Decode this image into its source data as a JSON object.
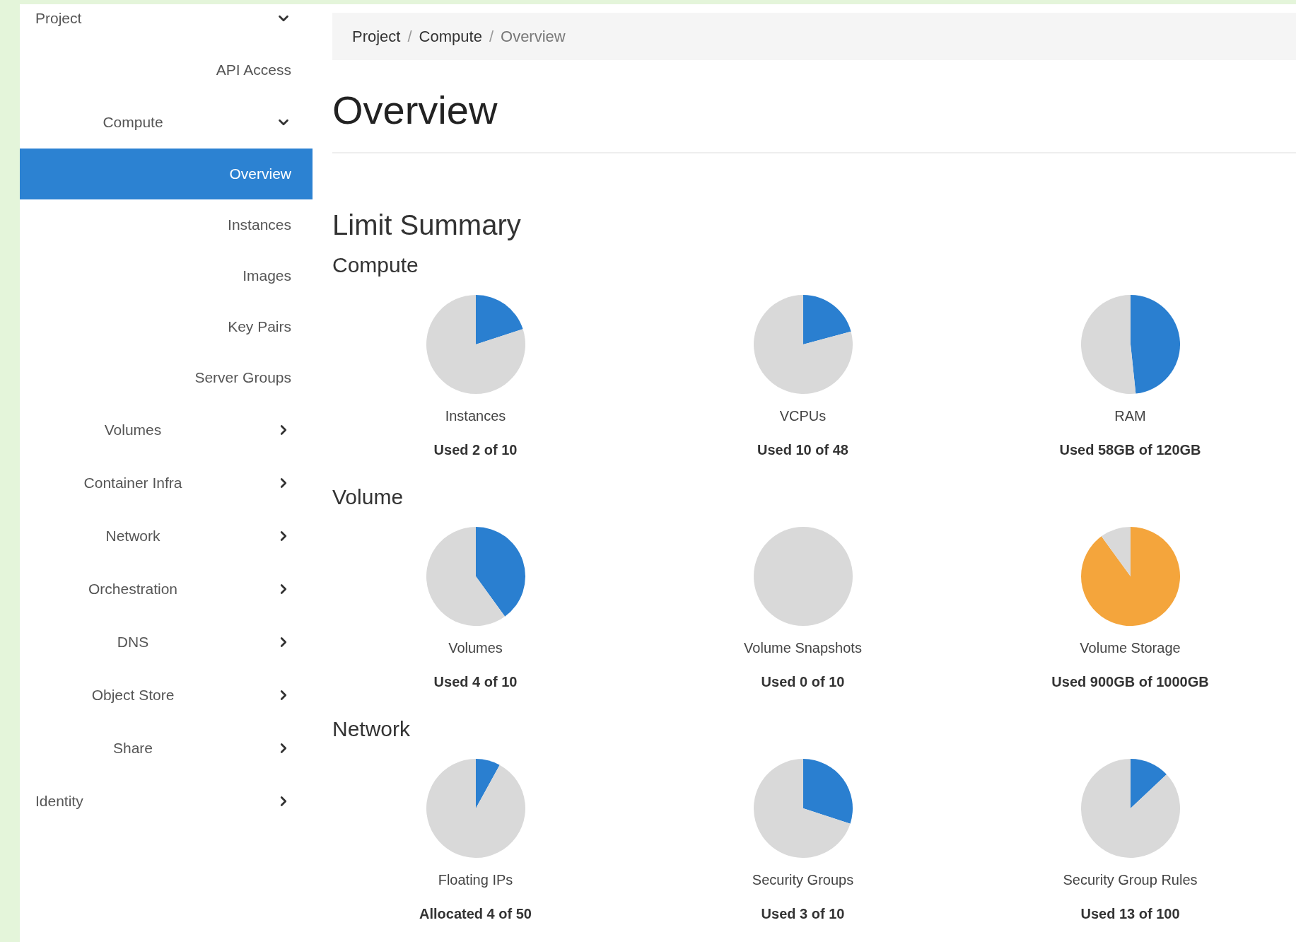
{
  "sidebar": {
    "items": [
      {
        "kind": "section",
        "label": "Project",
        "expanded": true,
        "selected": false
      },
      {
        "kind": "link",
        "label": "API Access",
        "selected": false
      },
      {
        "kind": "group",
        "label": "Compute",
        "expanded": true,
        "selected": false
      },
      {
        "kind": "link",
        "label": "Overview",
        "selected": true
      },
      {
        "kind": "link",
        "label": "Instances",
        "selected": false
      },
      {
        "kind": "link",
        "label": "Images",
        "selected": false
      },
      {
        "kind": "link",
        "label": "Key Pairs",
        "selected": false
      },
      {
        "kind": "link",
        "label": "Server Groups",
        "selected": false
      },
      {
        "kind": "group",
        "label": "Volumes",
        "expanded": false,
        "selected": false
      },
      {
        "kind": "group",
        "label": "Container Infra",
        "expanded": false,
        "selected": false
      },
      {
        "kind": "group",
        "label": "Network",
        "expanded": false,
        "selected": false
      },
      {
        "kind": "group",
        "label": "Orchestration",
        "expanded": false,
        "selected": false
      },
      {
        "kind": "group",
        "label": "DNS",
        "expanded": false,
        "selected": false
      },
      {
        "kind": "group",
        "label": "Object Store",
        "expanded": false,
        "selected": false
      },
      {
        "kind": "group",
        "label": "Share",
        "expanded": false,
        "selected": false
      },
      {
        "kind": "section",
        "label": "Identity",
        "expanded": false,
        "selected": false
      }
    ]
  },
  "breadcrumb": {
    "separator": "/",
    "items": [
      "Project",
      "Compute",
      "Overview"
    ]
  },
  "page_title": "Overview",
  "summary_title": "Limit Summary",
  "sections": [
    {
      "title": "Compute",
      "charts": [
        {
          "label": "Instances",
          "usage": "Used 2 of 10",
          "color": "#2a7fd0",
          "chart_data": {
            "type": "pie",
            "values": [
              20,
              80
            ]
          }
        },
        {
          "label": "VCPUs",
          "usage": "Used 10 of 48",
          "color": "#2a7fd0",
          "chart_data": {
            "type": "pie",
            "values": [
              20.83,
              79.17
            ]
          }
        },
        {
          "label": "RAM",
          "usage": "Used 58GB of 120GB",
          "color": "#2a7fd0",
          "chart_data": {
            "type": "pie",
            "values": [
              48.33,
              51.67
            ]
          }
        }
      ]
    },
    {
      "title": "Volume",
      "charts": [
        {
          "label": "Volumes",
          "usage": "Used 4 of 10",
          "color": "#2a7fd0",
          "chart_data": {
            "type": "pie",
            "values": [
              40,
              60
            ]
          }
        },
        {
          "label": "Volume Snapshots",
          "usage": "Used 0 of 10",
          "chart_data": {
            "type": "pie",
            "values": [
              0,
              100
            ]
          }
        },
        {
          "label": "Volume Storage",
          "usage": "Used 900GB of 1000GB",
          "color": "#f4a53c",
          "chart_data": {
            "type": "pie",
            "values": [
              90,
              10
            ]
          }
        }
      ]
    },
    {
      "title": "Network",
      "charts": [
        {
          "label": "Floating IPs",
          "usage": "Allocated 4 of 50",
          "color": "#2a7fd0",
          "chart_data": {
            "type": "pie",
            "values": [
              8,
              92
            ]
          }
        },
        {
          "label": "Security Groups",
          "usage": "Used 3 of 10",
          "color": "#2a7fd0",
          "chart_data": {
            "type": "pie",
            "values": [
              30,
              70
            ]
          }
        },
        {
          "label": "Security Group Rules",
          "usage": "Used 13 of 100",
          "color": "#2a7fd0",
          "chart_data": {
            "type": "pie",
            "values": [
              13,
              87
            ]
          }
        }
      ]
    }
  ]
}
